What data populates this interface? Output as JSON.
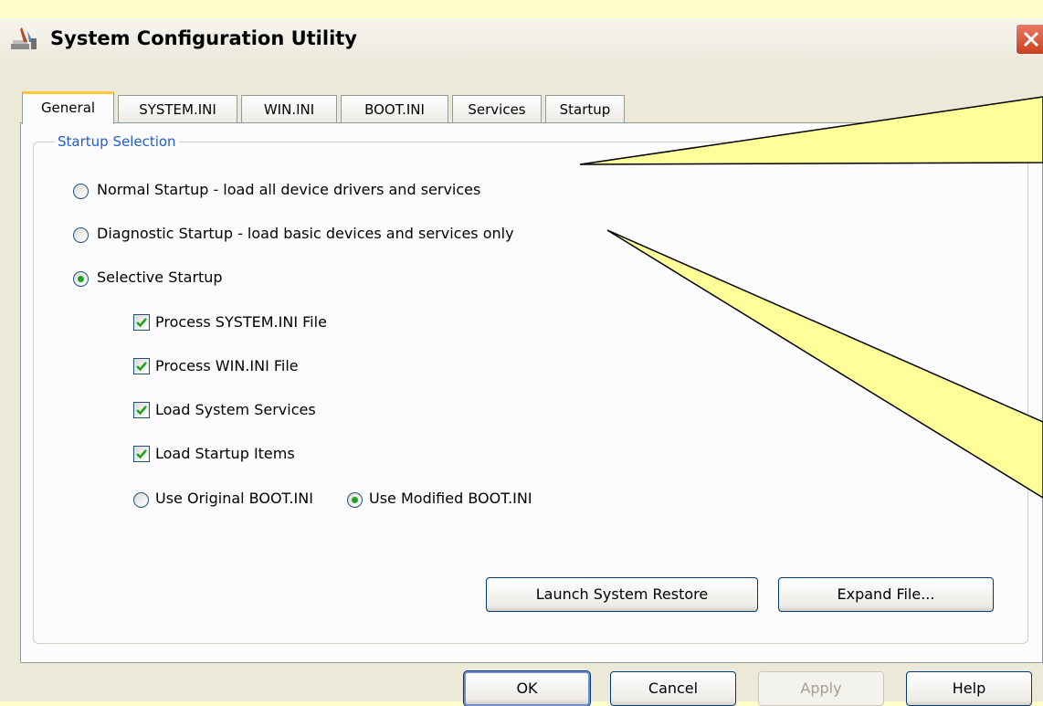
{
  "window": {
    "title": "System Configuration Utility",
    "icon": "system-config-icon",
    "close_icon": "close-icon"
  },
  "tabs": [
    {
      "label": "General",
      "active": true
    },
    {
      "label": "SYSTEM.INI",
      "active": false
    },
    {
      "label": "WIN.INI",
      "active": false
    },
    {
      "label": "BOOT.INI",
      "active": false
    },
    {
      "label": "Services",
      "active": false
    },
    {
      "label": "Startup",
      "active": false
    }
  ],
  "startup_selection": {
    "group_label": "Startup Selection",
    "normal": {
      "label": "Normal Startup - load all device drivers and services",
      "selected": false
    },
    "diagnostic": {
      "label": "Diagnostic Startup - load basic devices and services only",
      "selected": false
    },
    "selective": {
      "label": "Selective Startup",
      "selected": true
    },
    "checkboxes": [
      {
        "label": "Process SYSTEM.INI File",
        "checked": true
      },
      {
        "label": "Process WIN.INI File",
        "checked": true
      },
      {
        "label": "Load System Services",
        "checked": true
      },
      {
        "label": "Load Startup Items",
        "checked": true
      }
    ],
    "boot_original": {
      "label": "Use Original BOOT.INI",
      "selected": false
    },
    "boot_modified": {
      "label": "Use Modified BOOT.INI",
      "selected": true
    }
  },
  "panel_buttons": {
    "launch_restore": "Launch System Restore",
    "expand_file": "Expand File..."
  },
  "dialog_buttons": {
    "ok": "OK",
    "cancel": "Cancel",
    "apply": "Apply",
    "help": "Help"
  },
  "colors": {
    "background": "#ffffcc",
    "window": "#ece9d8",
    "group_label": "#1e5cd3",
    "tab_highlight": "#ffc83c",
    "callout_fill": "#ffff99"
  }
}
